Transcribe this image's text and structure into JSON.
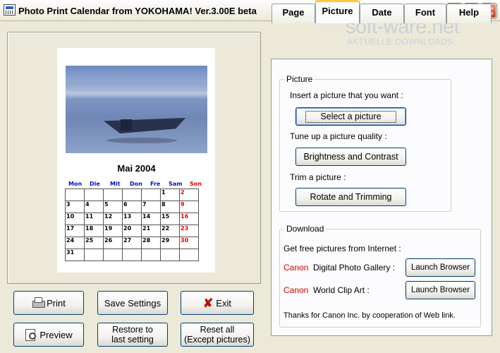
{
  "window": {
    "title": "Photo Print Calendar from YOKOHAMA! Ver.3.00E beta"
  },
  "watermark": {
    "brand": "soft-ware.net",
    "tagline": "AKTUELLE DOWNLOADS"
  },
  "calendar": {
    "month_title": "Mai 2004",
    "weekdays": [
      "Mon",
      "Die",
      "Mit",
      "Don",
      "Fre",
      "Sam",
      "Son"
    ],
    "weeks": [
      [
        "",
        "",
        "",
        "",
        "",
        "1",
        "2"
      ],
      [
        "3",
        "4",
        "5",
        "6",
        "7",
        "8",
        "9"
      ],
      [
        "10",
        "11",
        "12",
        "13",
        "14",
        "15",
        "16"
      ],
      [
        "17",
        "18",
        "19",
        "20",
        "21",
        "22",
        "23"
      ],
      [
        "24",
        "25",
        "26",
        "27",
        "28",
        "29",
        "30"
      ],
      [
        "31",
        "",
        "",
        "",
        "",
        "",
        ""
      ]
    ],
    "colors": {
      "weekday": "#0010C0",
      "sunday": "#E00000"
    }
  },
  "buttons": {
    "print": "Print",
    "preview": "Preview",
    "save_settings": "Save Settings",
    "restore_line1": "Restore to",
    "restore_line2": "last setting",
    "exit": "Exit",
    "reset_line1": "Reset all",
    "reset_line2": "(Except pictures)"
  },
  "tabs": [
    {
      "label": "Page"
    },
    {
      "label": "Picture",
      "active": true
    },
    {
      "label": "Date"
    },
    {
      "label": "Font"
    },
    {
      "label": "Help"
    }
  ],
  "picture_group": {
    "label": "Picture",
    "insert_text": "Insert a picture that you want :",
    "select_button": "Select a picture",
    "tune_text": "Tune up a picture quality :",
    "brightness_button": "Brightness and Contrast",
    "trim_text": "Trim a picture :",
    "rotate_button": "Rotate and Trimming"
  },
  "download_group": {
    "label": "Download",
    "intro": "Get free pictures from Internet :",
    "items": [
      {
        "brand": "Canon",
        "name": "Digital Photo Gallery :",
        "button": "Launch Browser"
      },
      {
        "brand": "Canon",
        "name": "World Clip Art :",
        "button": "Launch Browser"
      }
    ],
    "thanks": "Thanks for Canon Inc. by cooperation of Web link."
  }
}
